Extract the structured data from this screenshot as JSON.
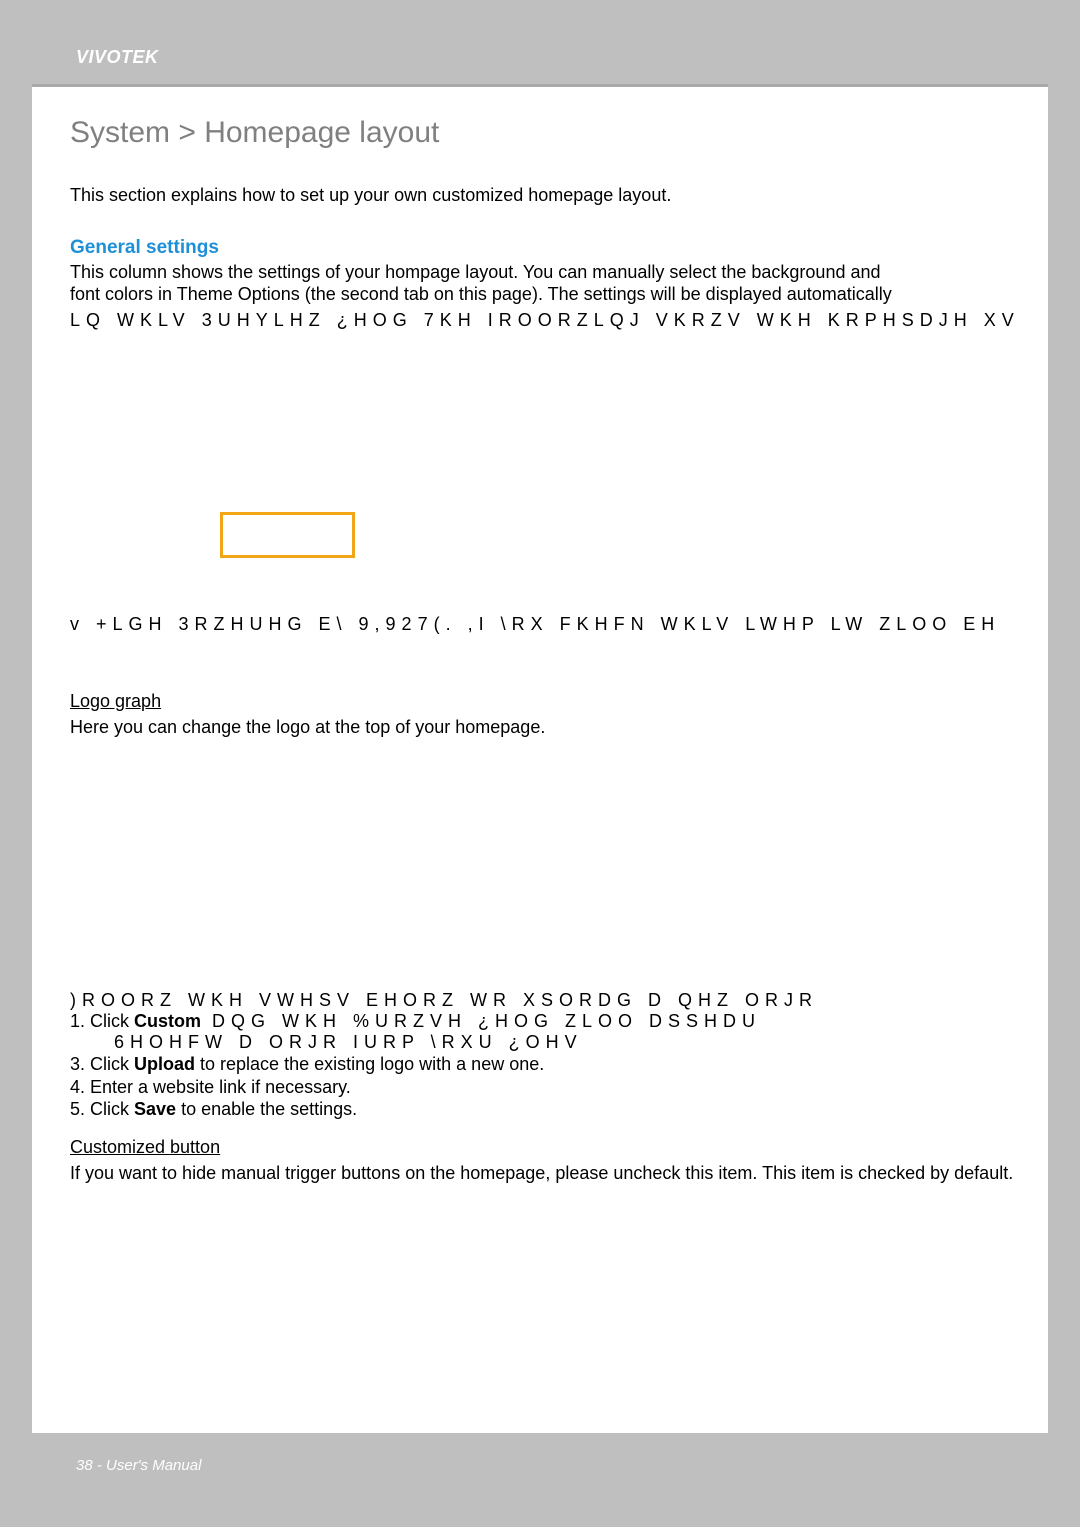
{
  "brand": "VIVOTEK",
  "title": "System > Homepage layout",
  "intro": "This section explains how to set up your own customized homepage layout.",
  "general": {
    "heading": "General settings",
    "p1a": "This column shows the settings of your hompage layout. You can manually select the background and",
    "p1b": "font colors in Theme Options (the second tab on this page). The settings will be displayed automatically",
    "p1c": "LQ WKLV 3UHYLHZ ¿HOG  7KH IROORZLQJ VKRZV WKH KRPHSDJH XV"
  },
  "bullet": "v +LGH 3RZHUHG E\\ 9,927(.  ,I \\RX FKHFN WKLV LWHP  LW ZLOO EH",
  "logo": {
    "heading": "Logo graph",
    "p": "Here you can change the logo at the top of your homepage."
  },
  "steps": {
    "intro": ")ROORZ WKH VWHSV EHORZ WR XSORDG D QHZ ORJR",
    "s1a": "1. Click ",
    "s1bold": "Custom",
    "s1b": "  DQG WKH %URZVH ¿HOG ZLOO DSSHDU",
    "s2": "6HOHFW D ORJR IURP \\RXU ¿OHV",
    "s3a": "3. Click ",
    "s3bold": "Upload",
    "s3b": " to replace the existing logo with a new one.",
    "s4": "4. Enter a website link if necessary.",
    "s5a": "5. Click ",
    "s5bold": "Save",
    "s5b": " to enable the settings."
  },
  "custom_button": {
    "heading": "Customized button",
    "p": "If you want to hide manual trigger buttons on the homepage, please uncheck this item. This item is checked by default."
  },
  "footer": "38 - User's Manual"
}
